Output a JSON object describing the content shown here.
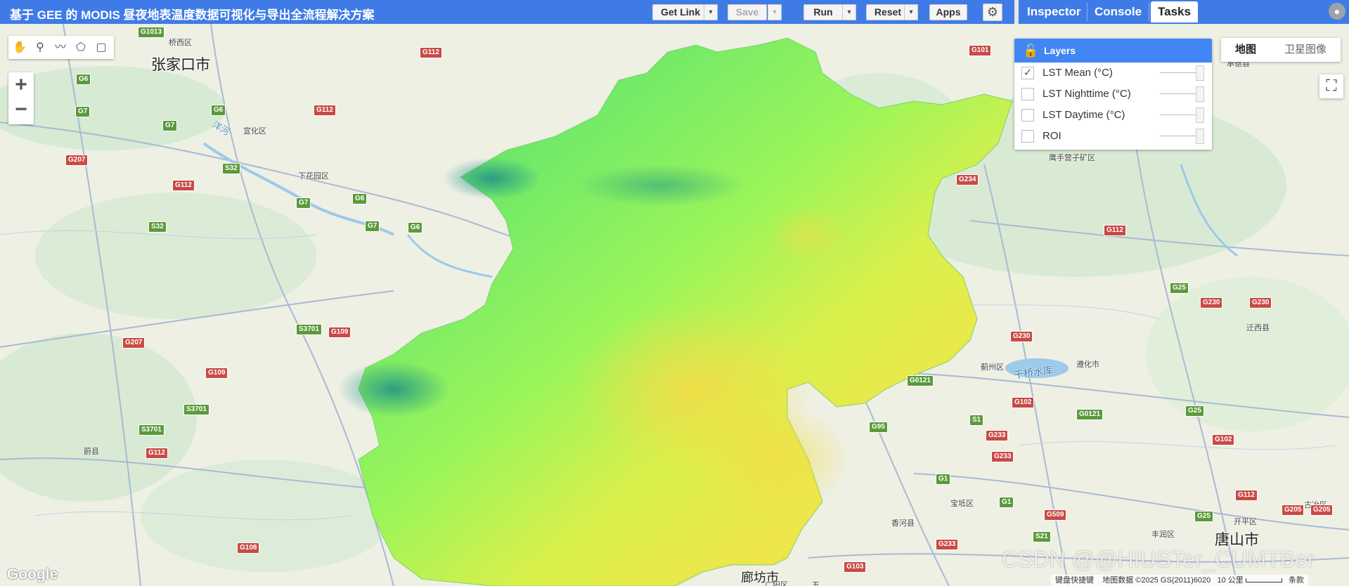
{
  "app": {
    "title": "基于 GEE 的 MODIS 昼夜地表温度数据可视化与导出全流程解决方案"
  },
  "toolbar": {
    "get_link": "Get Link",
    "save": "Save",
    "run": "Run",
    "reset": "Reset",
    "apps": "Apps",
    "caret": "▾",
    "gear": "⚙"
  },
  "right_tabs": {
    "inspector": "Inspector",
    "console": "Console",
    "tasks": "Tasks",
    "active": "Tasks"
  },
  "map_tools": {
    "icons": [
      "hand-icon",
      "marker-icon",
      "line-icon",
      "polygon-icon",
      "rectangle-icon"
    ],
    "glyphs": [
      "✋",
      "⚲",
      "〰",
      "⬠",
      "▢"
    ],
    "zoom_in": "+",
    "zoom_out": "−"
  },
  "layers_panel": {
    "title": "Layers",
    "lock_glyph": "🔓",
    "items": [
      {
        "name": "LST Mean (°C)",
        "checked": true,
        "check_glyph": "✓"
      },
      {
        "name": "LST Nighttime (°C)",
        "checked": false,
        "check_glyph": ""
      },
      {
        "name": "LST Daytime (°C)",
        "checked": false,
        "check_glyph": ""
      },
      {
        "name": "ROI",
        "checked": false,
        "check_glyph": ""
      }
    ]
  },
  "map_type": {
    "map": "地图",
    "satellite": "卫星图像",
    "active": "地图"
  },
  "map_labels": {
    "cities": {
      "zhangjiakou": "张家口市",
      "langfang": "廊坊市",
      "tangshan": "唐山市"
    },
    "places": {
      "qiaoxi": "桥西区",
      "xuanhua": "宣化区",
      "xiahuayuan": "下花园区",
      "yanghe": "洋河",
      "yuxian": "蔚县",
      "jizhou": "蓟州区",
      "qiaoshuiku": "千桥水库",
      "zunhua": "遵化市",
      "qianxi": "迁西县",
      "yingshouying": "鹰手营子矿区",
      "chengde": "承德县",
      "baodi": "宝坻区",
      "xianghe": "香河县",
      "fengrun": "丰润区",
      "kaiping": "开平区",
      "guye": "古冶区",
      "guangyang": "广阳区",
      "wu": "五"
    },
    "roads": [
      {
        "id": "G6",
        "color": "green"
      },
      {
        "id": "G7",
        "color": "green"
      },
      {
        "id": "G1013",
        "color": "green"
      },
      {
        "id": "G112",
        "color": "red"
      },
      {
        "id": "G207",
        "color": "red"
      },
      {
        "id": "S32",
        "color": "green"
      },
      {
        "id": "G109",
        "color": "red"
      },
      {
        "id": "S3701",
        "color": "green"
      },
      {
        "id": "G108",
        "color": "red"
      },
      {
        "id": "G101",
        "color": "red"
      },
      {
        "id": "G234",
        "color": "red"
      },
      {
        "id": "G25",
        "color": "green"
      },
      {
        "id": "G230",
        "color": "red"
      },
      {
        "id": "G0121",
        "color": "green"
      },
      {
        "id": "G102",
        "color": "red"
      },
      {
        "id": "G95",
        "color": "green"
      },
      {
        "id": "S1",
        "color": "green"
      },
      {
        "id": "G233",
        "color": "red"
      },
      {
        "id": "G1",
        "color": "green"
      },
      {
        "id": "G509",
        "color": "red"
      },
      {
        "id": "S21",
        "color": "green"
      },
      {
        "id": "G103",
        "color": "red"
      },
      {
        "id": "G205",
        "color": "red"
      }
    ]
  },
  "footer": {
    "keyboard": "键盘快捷键",
    "attribution": "地图数据 ©2025 GS(2011)6020",
    "scale": "10 公里",
    "terms": "条款"
  },
  "watermark": "CSDN @@HIUSTer_CUMTBer",
  "google_logo": "Google",
  "colors": {
    "topbar": "#3f7be6",
    "layers_header": "#4285f4",
    "lst_cool": "#2f9e7e",
    "lst_mid": "#8cf25a",
    "lst_warm": "#f1e44a"
  }
}
